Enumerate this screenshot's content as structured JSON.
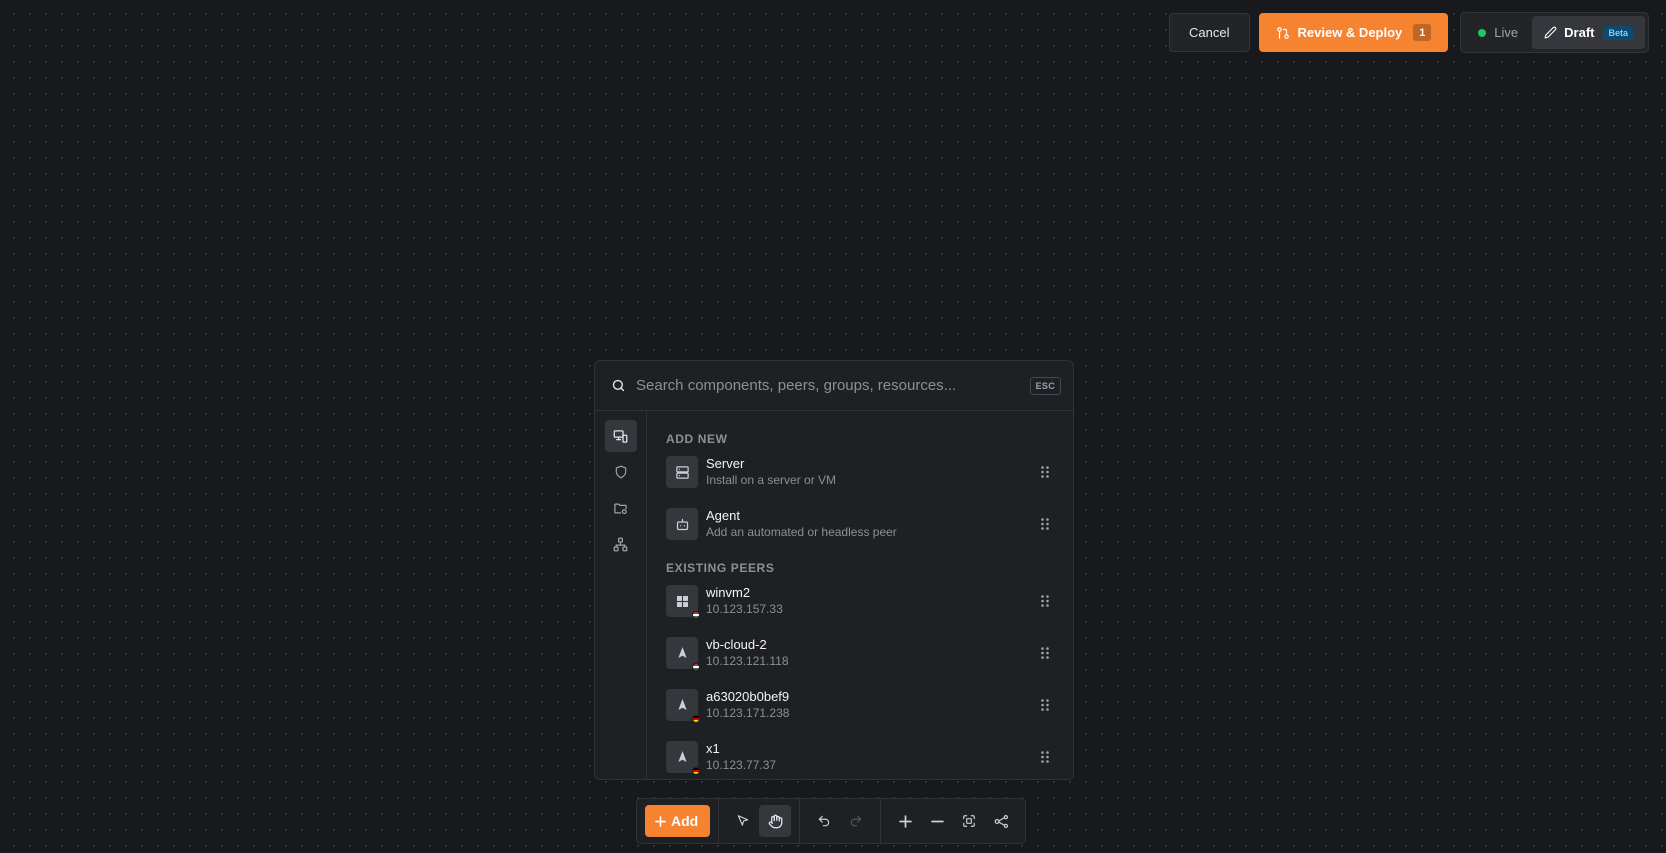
{
  "header": {
    "cancel_label": "Cancel",
    "deploy_label": "Review & Deploy",
    "deploy_count": "1",
    "mode_live_label": "Live",
    "mode_draft_label": "Draft",
    "beta_label": "Beta"
  },
  "search": {
    "placeholder": "Search components, peers, groups, resources...",
    "value": "",
    "esc_label": "ESC"
  },
  "sidebar": {
    "items": [
      {
        "icon": "peer-add-icon",
        "active": true
      },
      {
        "icon": "shield-icon",
        "active": false
      },
      {
        "icon": "folder-network-icon",
        "active": false
      },
      {
        "icon": "network-icon",
        "active": false
      }
    ]
  },
  "add_new": {
    "title": "ADD NEW",
    "items": [
      {
        "name": "Server",
        "description": "Install on a server or VM",
        "icon": "server-icon"
      },
      {
        "name": "Agent",
        "description": "Add an automated or headless peer",
        "icon": "bot-icon"
      }
    ]
  },
  "existing_peers": {
    "title": "EXISTING PEERS",
    "items": [
      {
        "name": "winvm2",
        "ip": "10.123.157.33",
        "os_icon": "windows-icon",
        "flag": "hungary-flag-icon"
      },
      {
        "name": "vb-cloud-2",
        "ip": "10.123.121.118",
        "os_icon": "linux-icon",
        "flag": "hungary-flag-icon"
      },
      {
        "name": "a63020b0bef9",
        "ip": "10.123.171.238",
        "os_icon": "linux-icon",
        "flag": "germany-flag-icon"
      },
      {
        "name": "x1",
        "ip": "10.123.77.37",
        "os_icon": "linux-icon",
        "flag": "germany-flag-icon"
      }
    ]
  },
  "toolbar": {
    "add_label": "Add"
  },
  "colors": {
    "accent": "#f68330",
    "live_status": "#22c55e",
    "background": "#18191c",
    "panel": "#1f2023"
  }
}
